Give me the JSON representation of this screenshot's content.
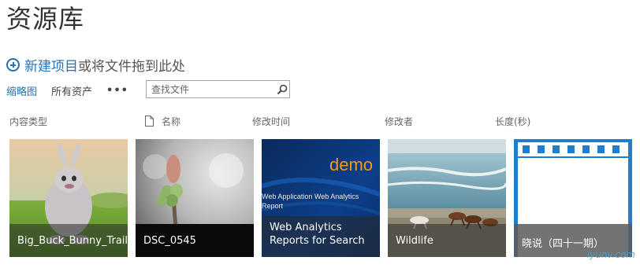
{
  "page": {
    "title": "资源库"
  },
  "actions": {
    "new_item": "新建项目",
    "drag_hint": "或将文件拖到此处"
  },
  "views": {
    "thumbnail": "缩略图",
    "all_assets": "所有资产",
    "more": "•••"
  },
  "search": {
    "placeholder": "查找文件"
  },
  "columns": {
    "content_type": "内容类型",
    "name": "名称",
    "modified": "修改时间",
    "modified_by": "修改者",
    "length": "长度(秒)"
  },
  "tiles": [
    {
      "caption": "Big_Buck_Bunny_Trailer"
    },
    {
      "caption": "DSC_0545"
    },
    {
      "caption": "Web Analytics Reports for Search",
      "slide_word": "demo",
      "slide_line1": "Web Application Web Analytics",
      "slide_line2": "Report"
    },
    {
      "caption": "Wildlife"
    },
    {
      "caption": "晓说（四十一期）"
    }
  ],
  "watermark": "iyunv.com",
  "colors": {
    "accent": "#2272b9",
    "tile_frame": "#1e7fd0",
    "demo_orange": "#f39a1c"
  }
}
